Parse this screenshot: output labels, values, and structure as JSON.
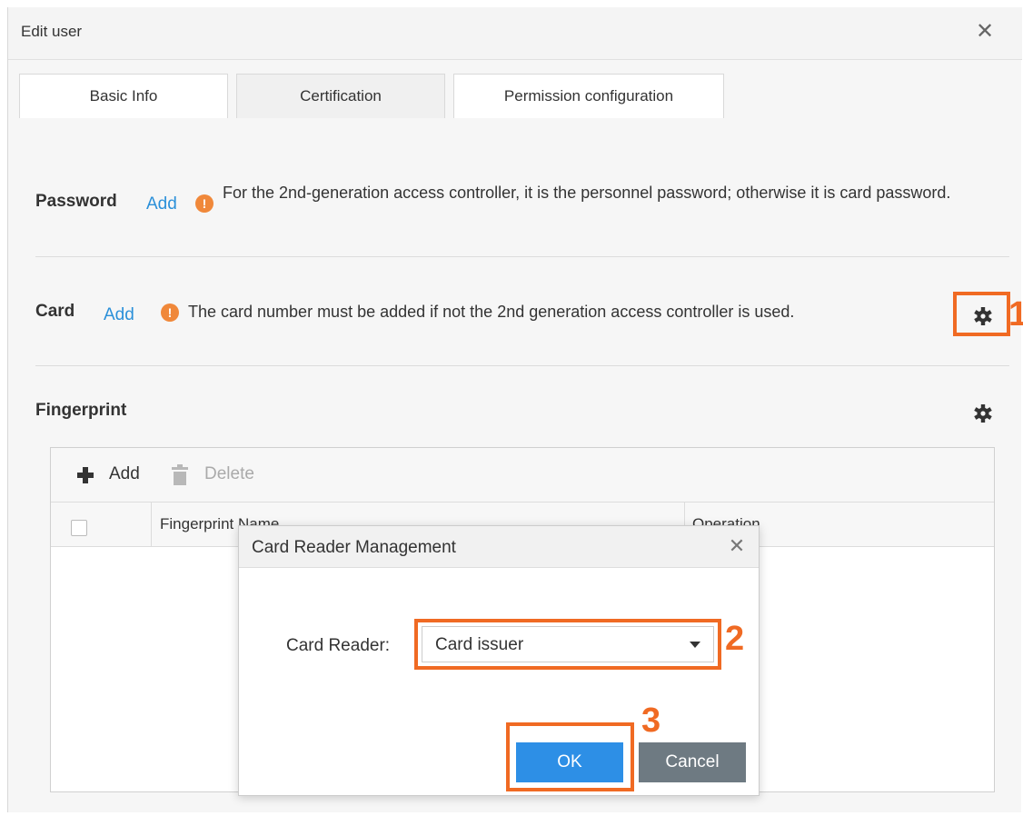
{
  "dialog": {
    "title": "Edit user",
    "close_symbol": "✕"
  },
  "tabs": [
    {
      "label": "Basic Info",
      "state": "inactive"
    },
    {
      "label": "Certification",
      "state": "active"
    },
    {
      "label": "Permission configuration",
      "state": "inactive"
    }
  ],
  "password": {
    "label": "Password",
    "add_label": "Add",
    "hint": "For the 2nd-generation access controller, it is the personnel password; otherwise it is card password."
  },
  "card": {
    "label": "Card",
    "add_label": "Add",
    "hint": "The card number must be added if not the 2nd generation access controller is used.",
    "settings_icon": "gear-icon"
  },
  "fingerprint": {
    "label": "Fingerprint",
    "settings_icon": "gear-icon",
    "toolbar": {
      "add_label": "Add",
      "delete_label": "Delete"
    },
    "columns": [
      "Fingerprint Name",
      "Operation"
    ],
    "rows": []
  },
  "card_reader_modal": {
    "title": "Card Reader Management",
    "close_symbol": "✕",
    "field_label": "Card Reader:",
    "selected_value": "Card issuer",
    "ok_label": "OK",
    "cancel_label": "Cancel"
  },
  "annotations": {
    "step1": "1",
    "step2": "2",
    "step3": "3",
    "highlight_color": "#f06a23"
  },
  "colors": {
    "link": "#2b90d9",
    "warning": "#f0883a",
    "primary_button": "#2d8fe6",
    "secondary_button": "#6e7a82"
  }
}
